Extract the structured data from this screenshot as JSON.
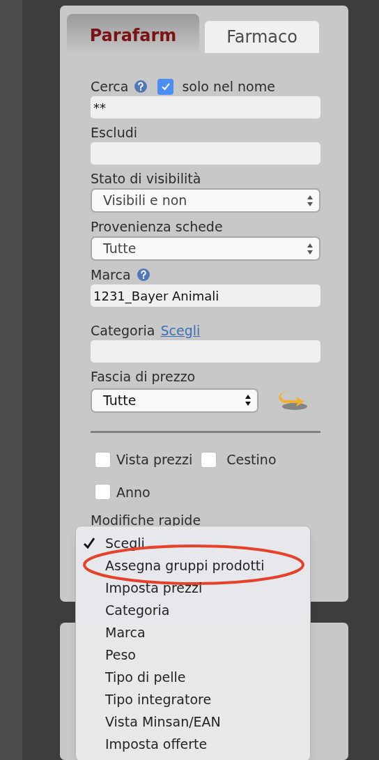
{
  "tabs": [
    {
      "label": "Parafarm",
      "selected": true
    },
    {
      "label": "Farmaco",
      "selected": false
    }
  ],
  "fields": [
    {
      "kind": "text",
      "label": "Cerca",
      "help": true,
      "option": {
        "label": "solo nel nome",
        "checked": true
      },
      "value": "**"
    },
    {
      "kind": "text",
      "label": "Escludi",
      "help": false
    },
    {
      "kind": "select",
      "label": "Stato di visibilità",
      "help": false,
      "value": "Visibili e non"
    },
    {
      "kind": "select",
      "label": "Provenienza schede",
      "help": false,
      "value": "Tutte"
    },
    {
      "kind": "text",
      "label": "Marca",
      "help": true,
      "value": "1231_Bayer Animali"
    },
    {
      "kind": "text",
      "label": "Categoria",
      "help": false,
      "link": "Scegli"
    },
    {
      "kind": "short_select",
      "label": "Fascia di prezzo",
      "help": false,
      "value": "Tutte"
    }
  ],
  "checkboxes": [
    {
      "label": "Vista prezzi",
      "checked": false
    },
    {
      "label": "Cestino",
      "checked": false
    },
    {
      "label": "Anno",
      "checked": false
    }
  ],
  "quick_edit": {
    "label": "Modifiche rapide",
    "menu": [
      {
        "label": "Scegli",
        "selected": true,
        "circled": false
      },
      {
        "label": "Assegna gruppi prodotti",
        "selected": false,
        "circled": true
      },
      {
        "label": "Imposta prezzi",
        "selected": false,
        "circled": false
      },
      {
        "label": "Categoria",
        "selected": false,
        "circled": false
      },
      {
        "label": "Marca",
        "selected": false,
        "circled": false
      },
      {
        "label": "Peso",
        "selected": false,
        "circled": false
      },
      {
        "label": "Tipo di pelle",
        "selected": false,
        "circled": false
      },
      {
        "label": "Tipo integratore",
        "selected": false,
        "circled": false
      },
      {
        "label": "Vista Minsan/EAN",
        "selected": false,
        "circled": false
      },
      {
        "label": "Imposta offerte",
        "selected": false,
        "circled": false
      }
    ]
  }
}
